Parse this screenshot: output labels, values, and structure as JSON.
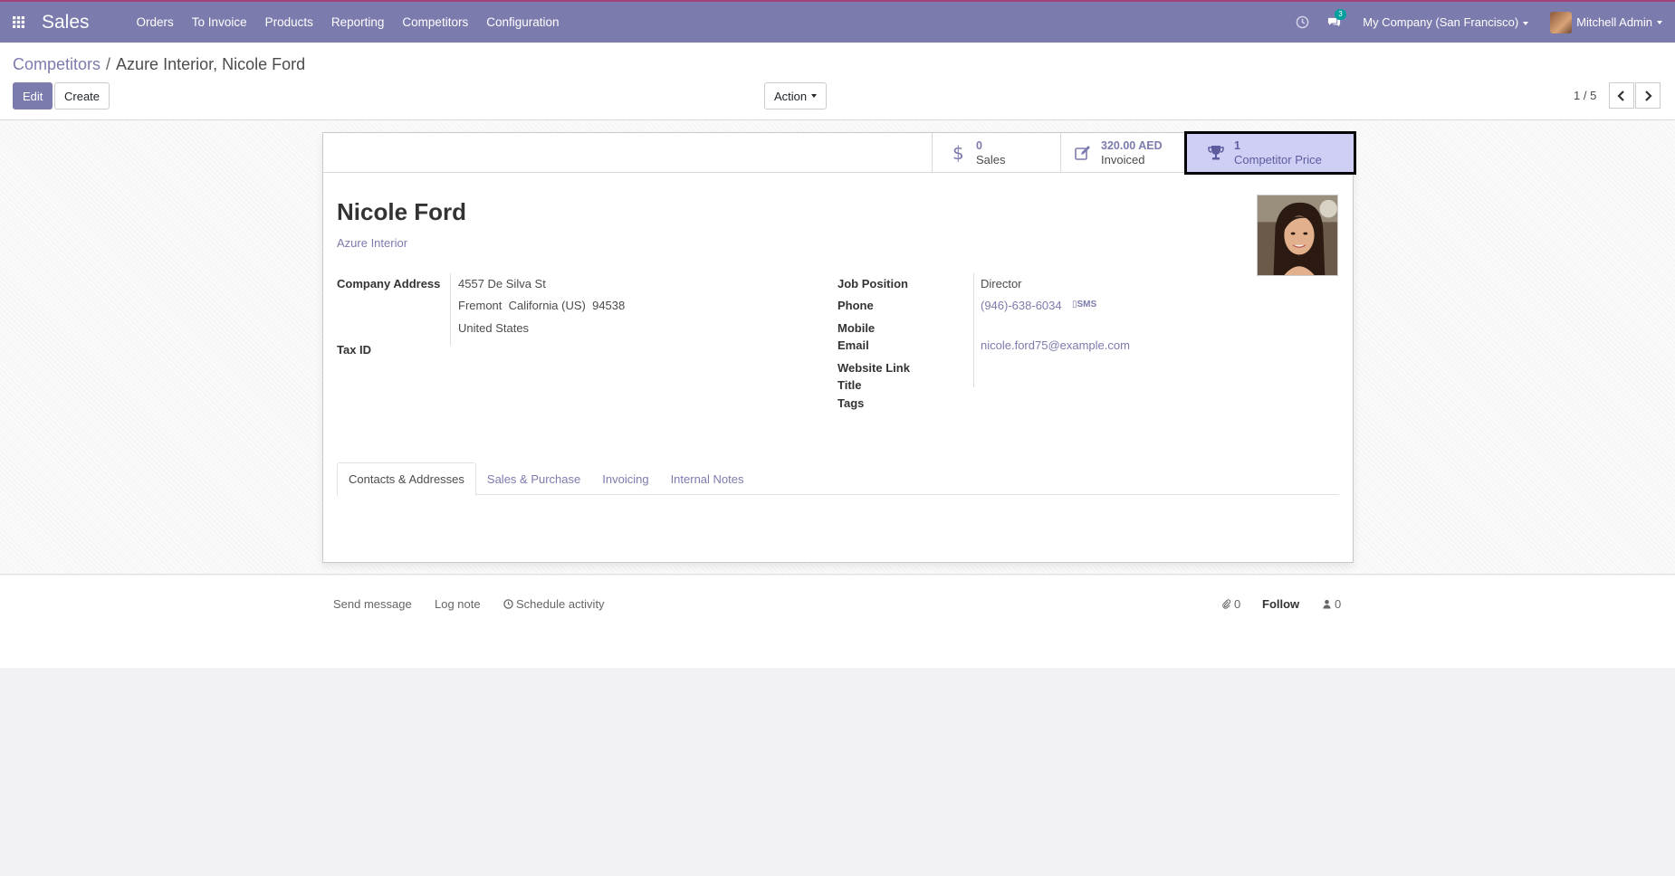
{
  "navbar": {
    "app_name": "Sales",
    "menu": [
      "Orders",
      "To Invoice",
      "Products",
      "Reporting",
      "Competitors",
      "Configuration"
    ],
    "messages_badge": "3",
    "company": "My Company (San Francisco)",
    "user": "Mitchell Admin",
    "bg_color": "#7c7bad"
  },
  "control_panel": {
    "breadcrumb_parent": "Competitors",
    "breadcrumb_separator": "/",
    "breadcrumb_current": "Azure Interior, Nicole Ford",
    "edit_label": "Edit",
    "create_label": "Create",
    "action_label": "Action",
    "pager": "1 / 5"
  },
  "stat_buttons": {
    "sales": {
      "value": "0",
      "label": "Sales",
      "icon": "dollar-icon"
    },
    "invoiced": {
      "value": "320.00 AED",
      "label": "Invoiced",
      "icon": "pencil-square-icon"
    },
    "competitor_price": {
      "value": "1",
      "label": "Competitor Price",
      "icon": "trophy-icon"
    }
  },
  "partner": {
    "name": "Nicole Ford",
    "parent": "Azure Interior"
  },
  "fields": {
    "company_address_label": "Company Address",
    "street": "4557 De Silva St",
    "city_line": "Fremont  California (US)  94538",
    "country": "United States",
    "tax_id_label": "Tax ID",
    "job_position_label": "Job Position",
    "job_position": "Director",
    "phone_label": "Phone",
    "phone": "(946)-638-6034",
    "sms_label": "SMS",
    "mobile_label": "Mobile",
    "email_label": "Email",
    "email": "nicole.ford75@example.com",
    "website_label": "Website Link",
    "title_label": "Title",
    "tags_label": "Tags"
  },
  "tabs": [
    "Contacts & Addresses",
    "Sales & Purchase",
    "Invoicing",
    "Internal Notes"
  ],
  "chatter": {
    "send_message": "Send message",
    "log_note": "Log note",
    "schedule_activity": "Schedule activity",
    "attachments_count": "0",
    "follow": "Follow",
    "followers_count": "0"
  }
}
